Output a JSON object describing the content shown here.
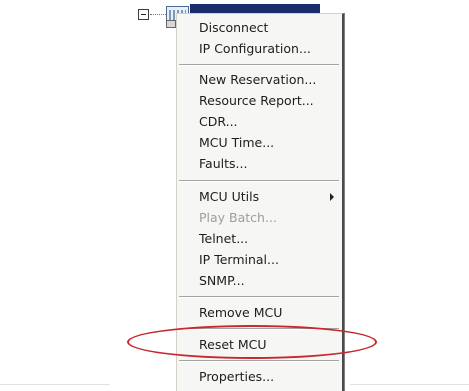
{
  "menu": {
    "items": [
      {
        "label": "Disconnect",
        "enabled": true
      },
      {
        "label": "IP Configuration...",
        "enabled": true
      },
      {
        "label": "New Reservation...",
        "enabled": true
      },
      {
        "label": "Resource Report...",
        "enabled": true
      },
      {
        "label": "CDR...",
        "enabled": true
      },
      {
        "label": "MCU Time...",
        "enabled": true
      },
      {
        "label": "Faults...",
        "enabled": true
      },
      {
        "label": "MCU Utils",
        "enabled": true,
        "has_submenu": true
      },
      {
        "label": "Play Batch...",
        "enabled": false
      },
      {
        "label": "Telnet...",
        "enabled": true
      },
      {
        "label": "IP Terminal...",
        "enabled": true
      },
      {
        "label": "SNMP...",
        "enabled": true
      },
      {
        "label": "Remove MCU",
        "enabled": true
      },
      {
        "label": "Reset MCU",
        "enabled": true,
        "highlighted_by_annotation": true
      },
      {
        "label": "Properties...",
        "enabled": true
      }
    ]
  },
  "annotation": {
    "color": "#c8282d",
    "shape": "ellipse",
    "target": "Reset MCU"
  },
  "colors": {
    "menu_background": "#f6f6f4",
    "selection": "#1a2c6b",
    "disabled_text": "#9e9e9e"
  }
}
